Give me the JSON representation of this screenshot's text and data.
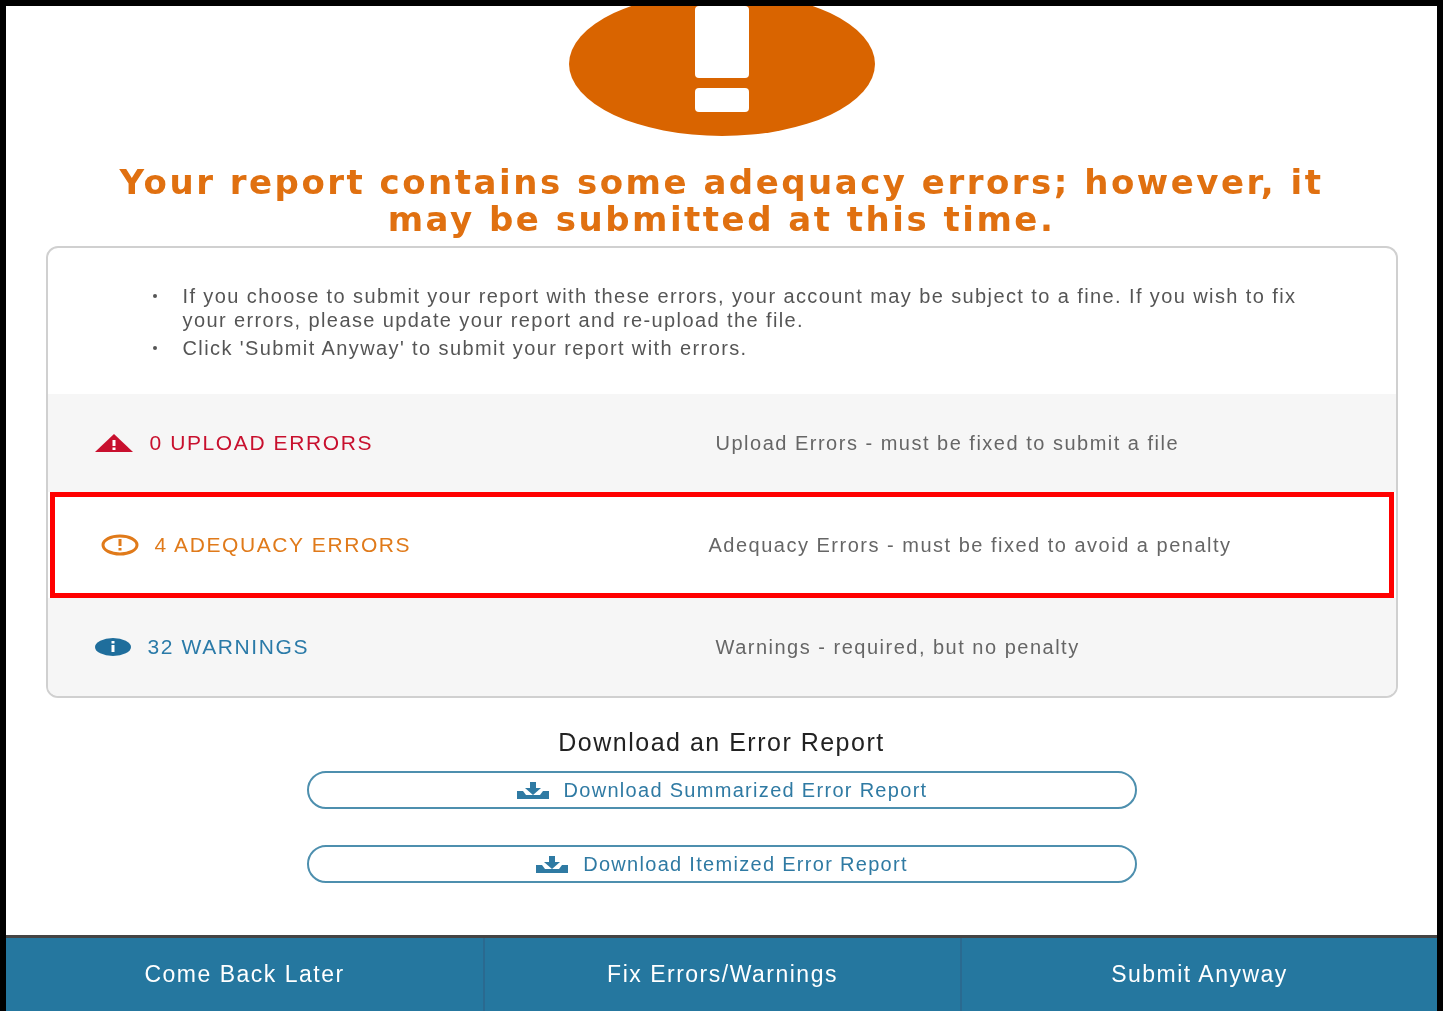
{
  "title": "Your report contains some adequacy errors; however, it may be submitted at this time.",
  "notes": [
    "If you choose to submit your report with these errors, your account may be subject to a fine. If you wish to fix your errors, please update your report and re-upload the file.",
    "Click 'Submit Anyway' to submit your report with errors."
  ],
  "categories": [
    {
      "kind": "error",
      "label": "0 UPLOAD ERRORS",
      "description": "Upload Errors - must be fixed to submit a file",
      "highlighted": false
    },
    {
      "kind": "adequacy",
      "label": "4 ADEQUACY ERRORS",
      "description": "Adequacy Errors - must be fixed to avoid a penalty",
      "highlighted": true
    },
    {
      "kind": "warning",
      "label": "32 WARNINGS",
      "description": "Warnings - required, but no penalty",
      "highlighted": false
    }
  ],
  "download": {
    "heading": "Download an Error Report",
    "buttons": [
      "Download Summarized Error Report",
      "Download Itemized Error Report"
    ]
  },
  "footer": [
    "Come Back Later",
    "Fix Errors/Warnings",
    "Submit Anyway"
  ]
}
